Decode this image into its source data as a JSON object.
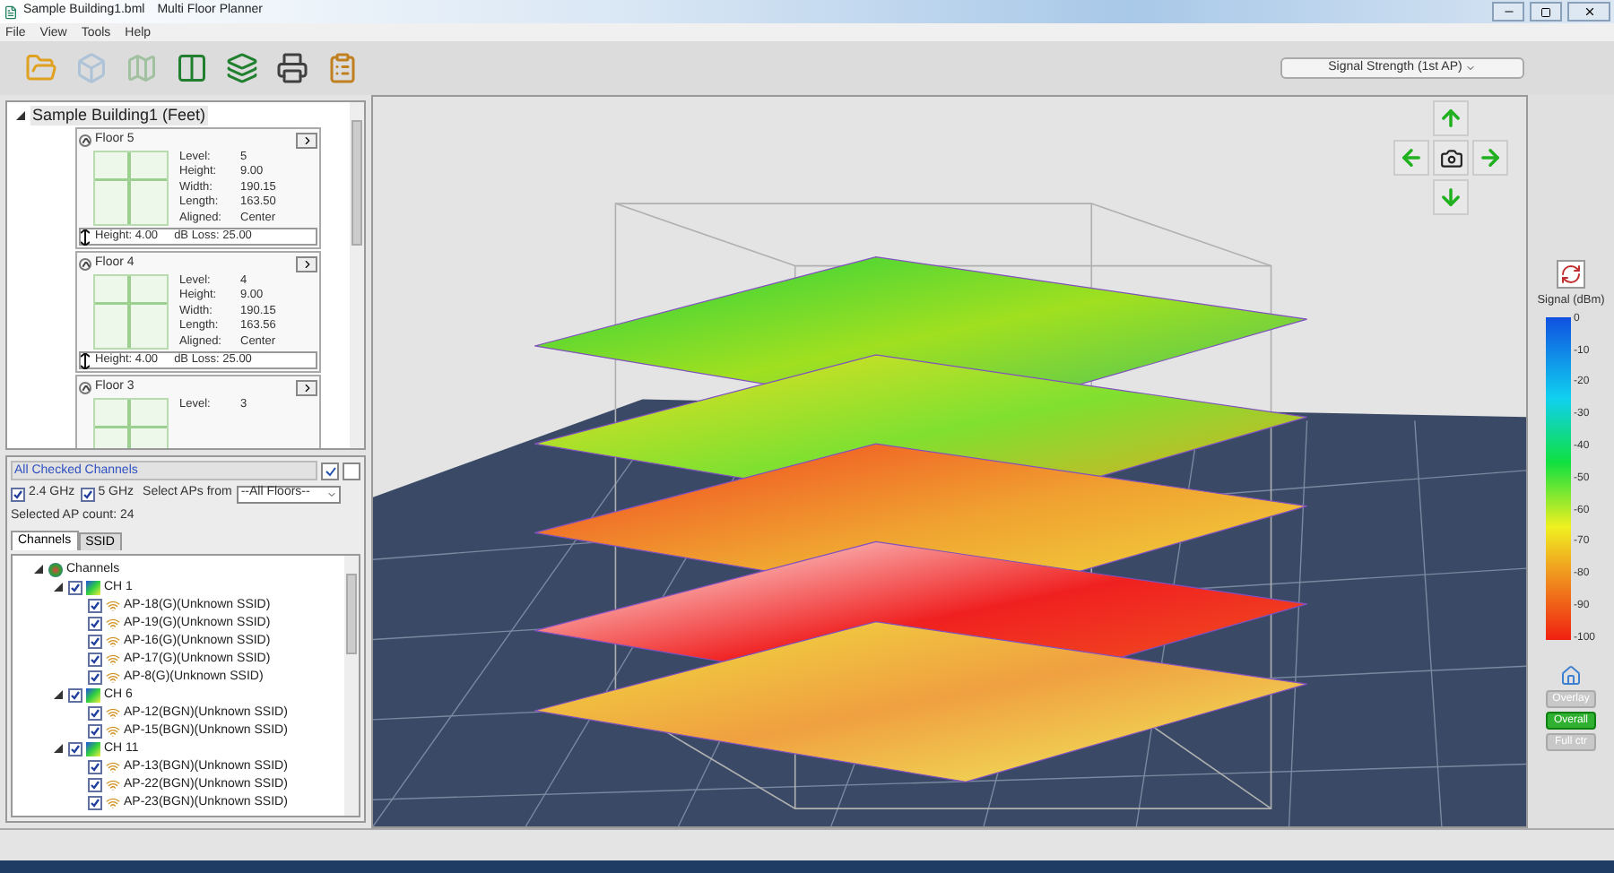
{
  "window": {
    "title": "Sample Building1.bml",
    "app_name": "Multi Floor Planner"
  },
  "menu": [
    "File",
    "View",
    "Tools",
    "Help"
  ],
  "toolbar": [
    {
      "kind": "open",
      "disabled": false
    },
    {
      "kind": "cube",
      "disabled": true
    },
    {
      "kind": "map",
      "disabled": true
    },
    {
      "kind": "panels",
      "disabled": false
    },
    {
      "kind": "layers",
      "disabled": false
    },
    {
      "kind": "print",
      "disabled": false
    },
    {
      "kind": "clipboard",
      "disabled": false
    }
  ],
  "view_select": {
    "value": "Signal Strength (1st AP)"
  },
  "building": {
    "name": "Sample Building1 (Feet)",
    "expanded": true,
    "floors": [
      {
        "name": "Floor 5",
        "fields": [
          {
            "label": "Level:",
            "value": "5"
          },
          {
            "label": "Height:",
            "value": "9.00"
          },
          {
            "label": "Width:",
            "value": "190.15"
          },
          {
            "label": "Length:",
            "value": "163.50"
          },
          {
            "label": "Aligned:",
            "value": "Center"
          }
        ],
        "gap_height": "Height: 4.00",
        "db_loss": "dB Loss: 25.00"
      },
      {
        "name": "Floor 4",
        "fields": [
          {
            "label": "Level:",
            "value": "4"
          },
          {
            "label": "Height:",
            "value": "9.00"
          },
          {
            "label": "Width:",
            "value": "190.15"
          },
          {
            "label": "Length:",
            "value": "163.56"
          },
          {
            "label": "Aligned:",
            "value": "Center"
          }
        ],
        "gap_height": "Height: 4.00",
        "db_loss": "dB Loss: 25.00"
      },
      {
        "name": "Floor 3",
        "fields": [
          {
            "label": "Level:",
            "value": "3"
          }
        ]
      }
    ]
  },
  "channels_panel": {
    "filter": "All Checked Channels",
    "bands": [
      {
        "label": "2.4 GHz",
        "checked": true
      },
      {
        "label": "5 GHz",
        "checked": true
      }
    ],
    "select_label": "Select APs from",
    "floor_select": "--All Floors--",
    "count": "Selected AP count: 24",
    "tabs": [
      {
        "label": "Channels",
        "selected": true
      },
      {
        "label": "SSID",
        "selected": false
      }
    ],
    "tree": [
      {
        "label": "Channels",
        "kind": "root",
        "expanded": true,
        "children": [
          {
            "label": "CH 1",
            "kind": "channel",
            "checked": true,
            "expanded": true,
            "children": [
              {
                "label": "AP-18(G)(Unknown SSID)",
                "kind": "ap",
                "checked": true
              },
              {
                "label": "AP-19(G)(Unknown SSID)",
                "kind": "ap",
                "checked": true
              },
              {
                "label": "AP-16(G)(Unknown SSID)",
                "kind": "ap",
                "checked": true
              },
              {
                "label": "AP-17(G)(Unknown SSID)",
                "kind": "ap",
                "checked": true
              },
              {
                "label": "AP-8(G)(Unknown SSID)",
                "kind": "ap",
                "checked": true
              }
            ]
          },
          {
            "label": "CH 6",
            "kind": "channel",
            "checked": true,
            "expanded": true,
            "children": [
              {
                "label": "AP-12(BGN)(Unknown SSID)",
                "kind": "ap",
                "checked": true
              },
              {
                "label": "AP-15(BGN)(Unknown SSID)",
                "kind": "ap",
                "checked": true
              }
            ]
          },
          {
            "label": "CH 11",
            "kind": "channel",
            "checked": true,
            "expanded": true,
            "children": [
              {
                "label": "AP-13(BGN)(Unknown SSID)",
                "kind": "ap",
                "checked": true
              },
              {
                "label": "AP-22(BGN)(Unknown SSID)",
                "kind": "ap",
                "checked": true
              },
              {
                "label": "AP-23(BGN)(Unknown SSID)",
                "kind": "ap",
                "checked": true
              }
            ]
          }
        ]
      }
    ]
  },
  "legend": {
    "title": "Signal (dBm)",
    "ticks": [
      "0",
      "-10",
      "-20",
      "-30",
      "-40",
      "-50",
      "-60",
      "-70",
      "-80",
      "-90",
      "-100"
    ],
    "buttons": [
      {
        "label": "Overlay",
        "selected": false
      },
      {
        "label": "Overall",
        "selected": true
      },
      {
        "label": "Full ctr",
        "selected": false
      }
    ]
  }
}
